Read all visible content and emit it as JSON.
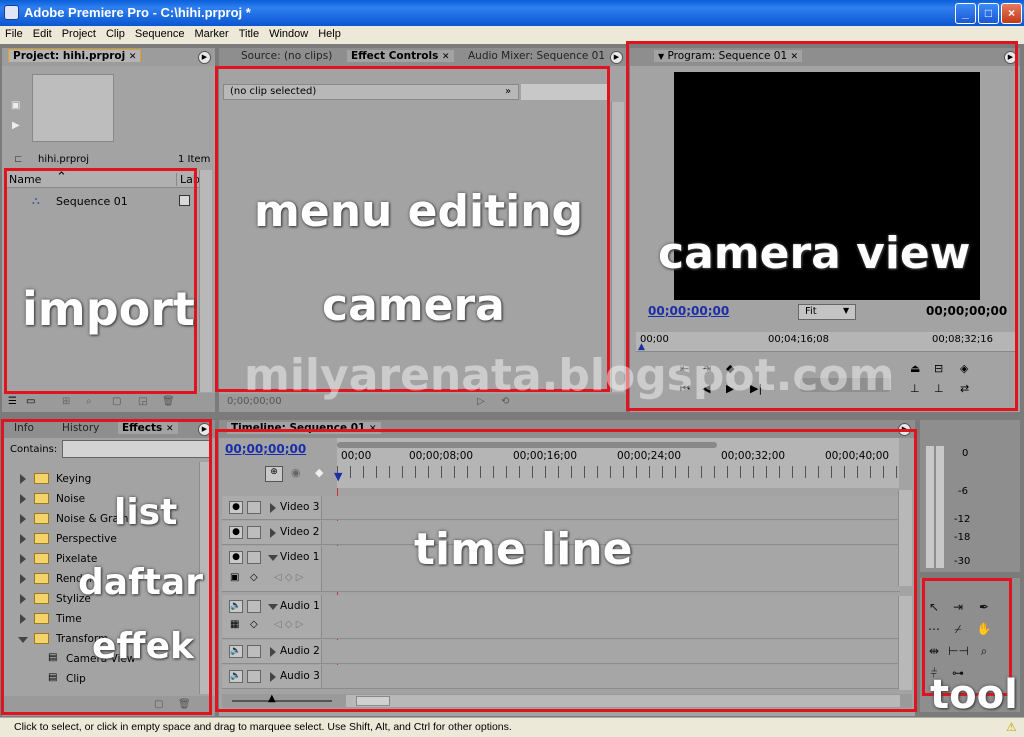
{
  "window": {
    "title": "Adobe Premiere Pro - C:\\hihi.prproj *",
    "minimize": "_",
    "maximize": "□",
    "close": "×"
  },
  "menu": [
    "File",
    "Edit",
    "Project",
    "Clip",
    "Sequence",
    "Marker",
    "Title",
    "Window",
    "Help"
  ],
  "project": {
    "tab": "Project: hihi.prproj",
    "file": "hihi.prproj",
    "count": "1 Item",
    "col_name": "Name",
    "col_label": "Lab",
    "item": "Sequence 01"
  },
  "effect_controls": {
    "tabs": [
      "Source: (no clips)",
      "Effect Controls",
      "Audio Mixer: Sequence 01"
    ],
    "status": "(no clip selected)",
    "time": "0;00;00;00"
  },
  "program": {
    "tab": "Program: Sequence 01",
    "timecode_left": "00;00;00;00",
    "fit": "Fit",
    "timecode_right": "00;00;00;00",
    "ruler": [
      "00;00",
      "00;04;16;08",
      "00;08;32;16"
    ]
  },
  "effects": {
    "tabs": [
      "Info",
      "History",
      "Effects"
    ],
    "contains_label": "Contains:",
    "folders": [
      "Keying",
      "Noise",
      "Noise & Grain",
      "Perspective",
      "Pixelate",
      "Render",
      "Stylize",
      "Time",
      "Transform"
    ],
    "items": [
      "Camera View",
      "Clip"
    ]
  },
  "timeline": {
    "tab": "Timeline: Sequence 01",
    "timecode": "00;00;00;00",
    "ruler": [
      "00;00",
      "00;00;08;00",
      "00;00;16;00",
      "00;00;24;00",
      "00;00;32;00",
      "00;00;40;00"
    ],
    "tracks": [
      "Video 3",
      "Video 2",
      "Video 1",
      "Audio 1",
      "Audio 2",
      "Audio 3"
    ]
  },
  "audio_meter": {
    "labels": [
      "0",
      "-6",
      "-12",
      "-18",
      "-30"
    ]
  },
  "status_bar": "Click to select, or click in empty space and drag to marquee select. Use Shift, Alt, and Ctrl for other options.",
  "annotations": {
    "import": "import",
    "menu_editing": "menu editing",
    "camera": "camera",
    "camera_view": "camera view",
    "list": "list",
    "daftar": "daftar",
    "effek": "effek",
    "time_line": "time line",
    "tool": "tool",
    "watermark": "milyarenata.blogspot.com"
  },
  "colors": {
    "annotation_box": "#e0141e",
    "timecode_blue": "#1a2ea8",
    "titlebar": "#0a5fd8"
  }
}
